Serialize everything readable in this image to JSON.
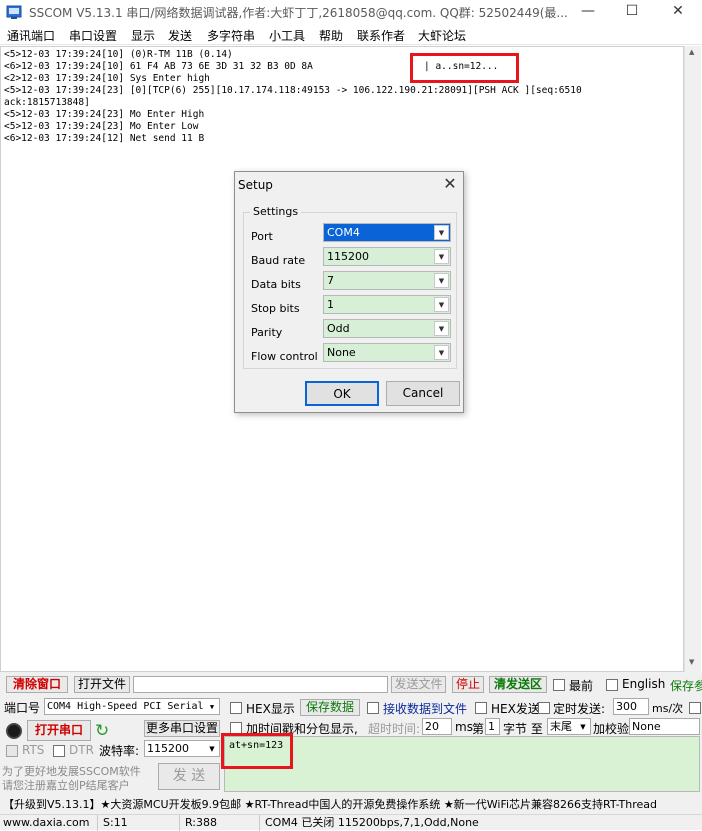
{
  "window": {
    "title": "SSCOM V5.13.1 串口/网络数据调试器,作者:大虾丁丁,2618058@qq.com. QQ群: 52502449(最...",
    "minimize": "—",
    "maximize": "☐",
    "close": "✕"
  },
  "menu": [
    "通讯端口",
    "串口设置",
    "显示",
    "发送",
    "多字符串",
    "小工具",
    "帮助",
    "联系作者",
    "大虾论坛"
  ],
  "log": {
    "lines": [
      "<5>12-03 17:39:24[10] (0)R-TM 11B (0.14)",
      "<6>12-03 17:39:24[10] 61 F4 AB 73 6E 3D 31 32 B3 0D 8A",
      "<2>12-03 17:39:24[10] Sys Enter high",
      " <5>12-03 17:39:24[23] [0][TCP(6) 255][10.17.174.118:49153 -> 106.122.190.21:28091][PSH ACK ][seq:6510",
      "ack:1815713848]",
      "<5>12-03 17:39:24[23] Mo Enter High",
      "<5>12-03 17:39:24[23] Mo Enter Low",
      "<6>12-03 17:39:24[12] Net send 11 B"
    ],
    "ascii_text": "| a..sn=12..."
  },
  "dialog": {
    "title": "Setup",
    "close": "✕",
    "group": "Settings",
    "fields": [
      {
        "label": "Port",
        "value": "COM4"
      },
      {
        "label": "Baud rate",
        "value": "115200"
      },
      {
        "label": "Data bits",
        "value": "7"
      },
      {
        "label": "Stop bits",
        "value": "1"
      },
      {
        "label": "Parity",
        "value": "Odd"
      },
      {
        "label": "Flow control",
        "value": "None"
      }
    ],
    "ok": "OK",
    "cancel": "Cancel"
  },
  "toolbar": {
    "clear": "清除窗口",
    "open_file": "打开文件",
    "send_file": "发送文件",
    "stop": "停止",
    "clear_send": "清发送区",
    "front": "最前",
    "english": "English",
    "save_params": "保存参"
  },
  "port": {
    "label": "端口号",
    "value": "COM4 High-Speed PCI Serial",
    "hex_display": "HEX显示",
    "save_data": "保存数据",
    "recv_to_file": "接收数据到文件",
    "hex_send": "HEX发送",
    "timed_send": "定时发送:",
    "interval": "300",
    "interval_unit": "ms/次",
    "open_port": "打开串口",
    "more_settings": "更多串口设置",
    "timestamp": "加时间戳和分包显示,",
    "timeout_label": "超时时间:",
    "timeout_value": "20",
    "timeout_unit": "ms",
    "nth_label": "第",
    "nth_value": "1",
    "byte_label": "字节 至",
    "end_value": "末尾",
    "checksum_label": "加校验",
    "checksum_value": "None",
    "rts": "RTS",
    "dtr": "DTR",
    "baud_label": "波特率:",
    "baud_value": "115200"
  },
  "send": {
    "text": "at+sn=123",
    "button": "发 送",
    "promo1": "为了更好地发展SSCOM软件",
    "promo2": "请您注册嘉立创P结尾客户"
  },
  "ad": "【升级到V5.13.1】★大资源MCU开发板9.9包邮 ★RT-Thread中国人的开源免费操作系统 ★新一代WiFi芯片兼容8266支持RT-Thread",
  "status": {
    "site": "www.daxia.com",
    "sent": "S:11",
    "recv": "R:388",
    "port_state": "COM4 已关闭  115200bps,7,1,Odd,None"
  },
  "colors": {
    "highlight": "#e8151b",
    "send_area": "#d9f2d4",
    "combo": "#d7eed7"
  }
}
